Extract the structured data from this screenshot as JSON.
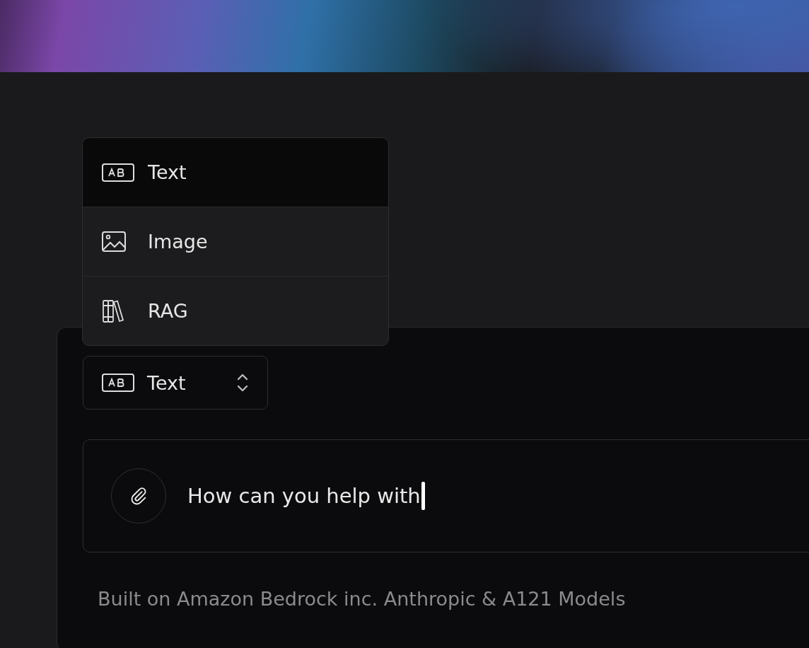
{
  "mode_menu": {
    "items": [
      {
        "kind": "text",
        "label": "Text",
        "selected": true
      },
      {
        "kind": "image",
        "label": "Image",
        "selected": false
      },
      {
        "kind": "rag",
        "label": "RAG",
        "selected": false
      }
    ]
  },
  "mode_selector": {
    "kind": "text",
    "label": "Text"
  },
  "message": {
    "value": "How can you help with"
  },
  "footer": "Built on Amazon Bedrock inc. Anthropic & A121 Models"
}
